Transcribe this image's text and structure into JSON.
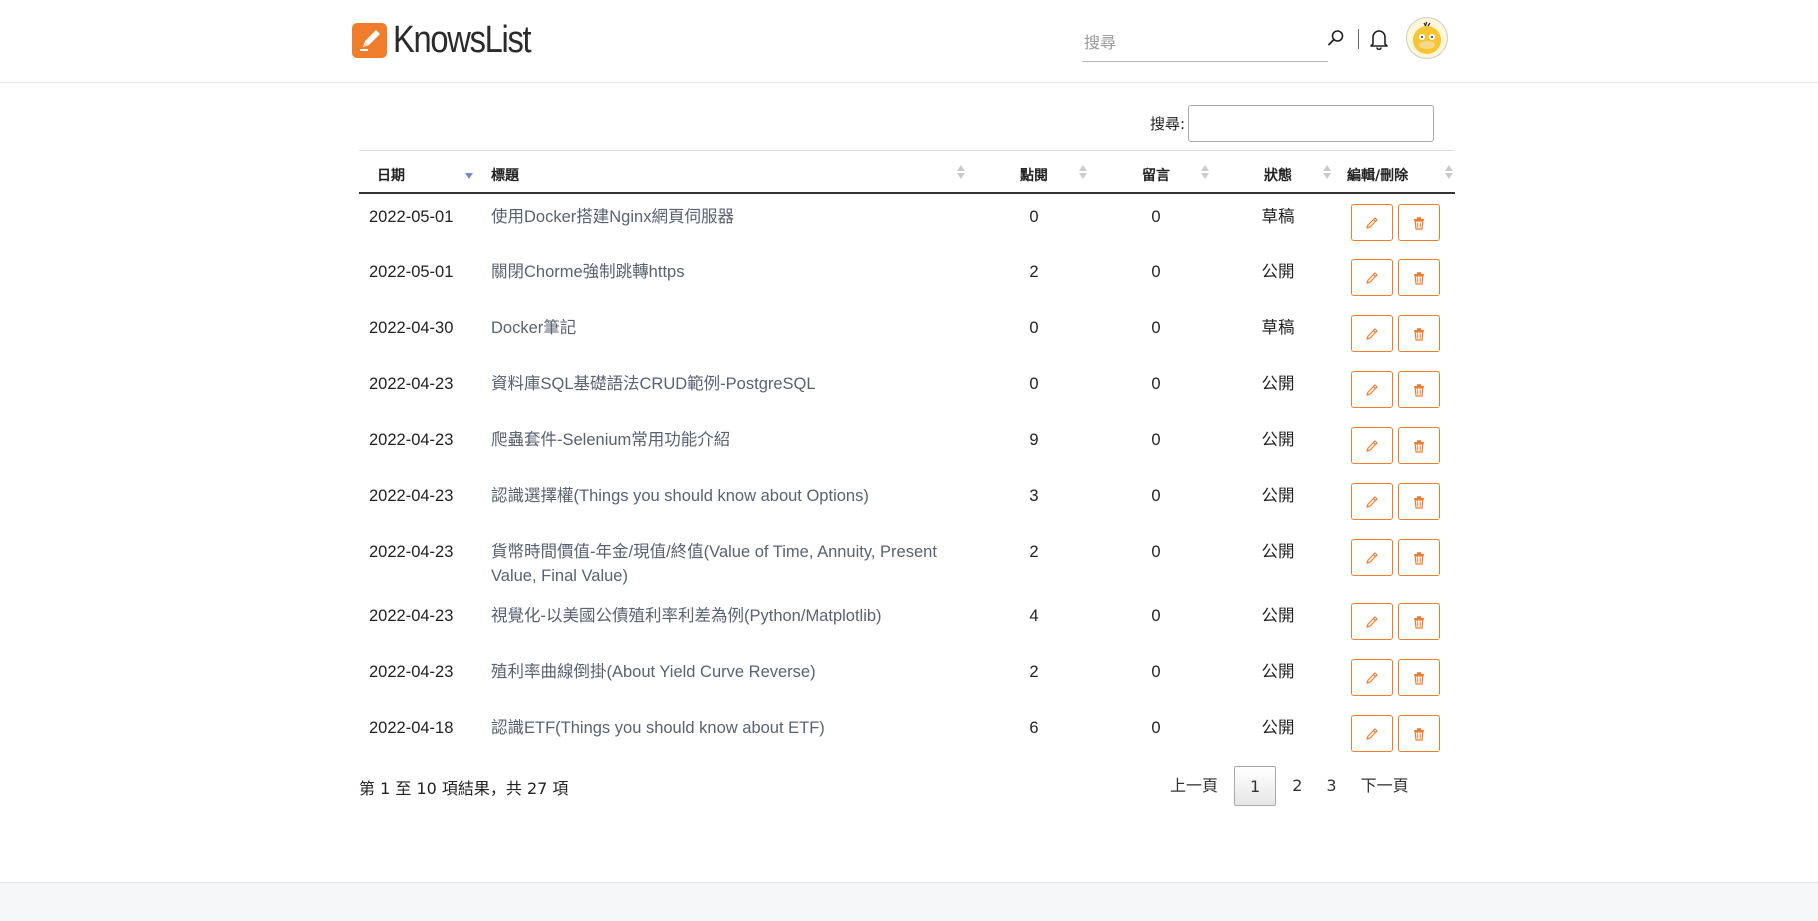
{
  "brand": {
    "name": "KnowsList"
  },
  "header": {
    "search_placeholder": "搜尋"
  },
  "filter": {
    "label": "搜尋:"
  },
  "columns": [
    {
      "label": "日期"
    },
    {
      "label": "標題"
    },
    {
      "label": "點閱"
    },
    {
      "label": "留言"
    },
    {
      "label": "狀態"
    },
    {
      "label": "編輯/刪除"
    }
  ],
  "rows": [
    {
      "date": "2022-05-01",
      "title": "使用Docker搭建Nginx網頁伺服器",
      "views": "0",
      "comments": "0",
      "status": "草稿"
    },
    {
      "date": "2022-05-01",
      "title": "關閉Chorme強制跳轉https",
      "views": "2",
      "comments": "0",
      "status": "公開"
    },
    {
      "date": "2022-04-30",
      "title": "Docker筆記",
      "views": "0",
      "comments": "0",
      "status": "草稿"
    },
    {
      "date": "2022-04-23",
      "title": "資料庫SQL基礎語法CRUD範例-PostgreSQL",
      "views": "0",
      "comments": "0",
      "status": "公開"
    },
    {
      "date": "2022-04-23",
      "title": "爬蟲套件-Selenium常用功能介紹",
      "views": "9",
      "comments": "0",
      "status": "公開"
    },
    {
      "date": "2022-04-23",
      "title": "認識選擇權(Things you should know about Options)",
      "views": "3",
      "comments": "0",
      "status": "公開"
    },
    {
      "date": "2022-04-23",
      "title": "貨幣時間價值-年金/現值/終值(Value of Time, Annuity, Present Value, Final Value)",
      "views": "2",
      "comments": "0",
      "status": "公開"
    },
    {
      "date": "2022-04-23",
      "title": "視覺化-以美國公債殖利率利差為例(Python/Matplotlib)",
      "views": "4",
      "comments": "0",
      "status": "公開"
    },
    {
      "date": "2022-04-23",
      "title": "殖利率曲線倒掛(About Yield Curve Reverse)",
      "views": "2",
      "comments": "0",
      "status": "公開"
    },
    {
      "date": "2022-04-18",
      "title": "認識ETF(Things you should know about ETF)",
      "views": "6",
      "comments": "0",
      "status": "公開"
    }
  ],
  "table_info": "第 1 至 10 項結果，共 27 項",
  "pagination": {
    "prev": "上一頁",
    "pages": [
      "1",
      "2",
      "3"
    ],
    "current": "1",
    "next": "下一頁"
  },
  "colors": {
    "accent": "#f07d2c",
    "link": "#5a6270",
    "sort_active": "#7b8bbd"
  },
  "icons": {
    "edit": "pencil-icon",
    "delete": "trash-icon",
    "search": "search-icon",
    "bell": "bell-icon"
  }
}
